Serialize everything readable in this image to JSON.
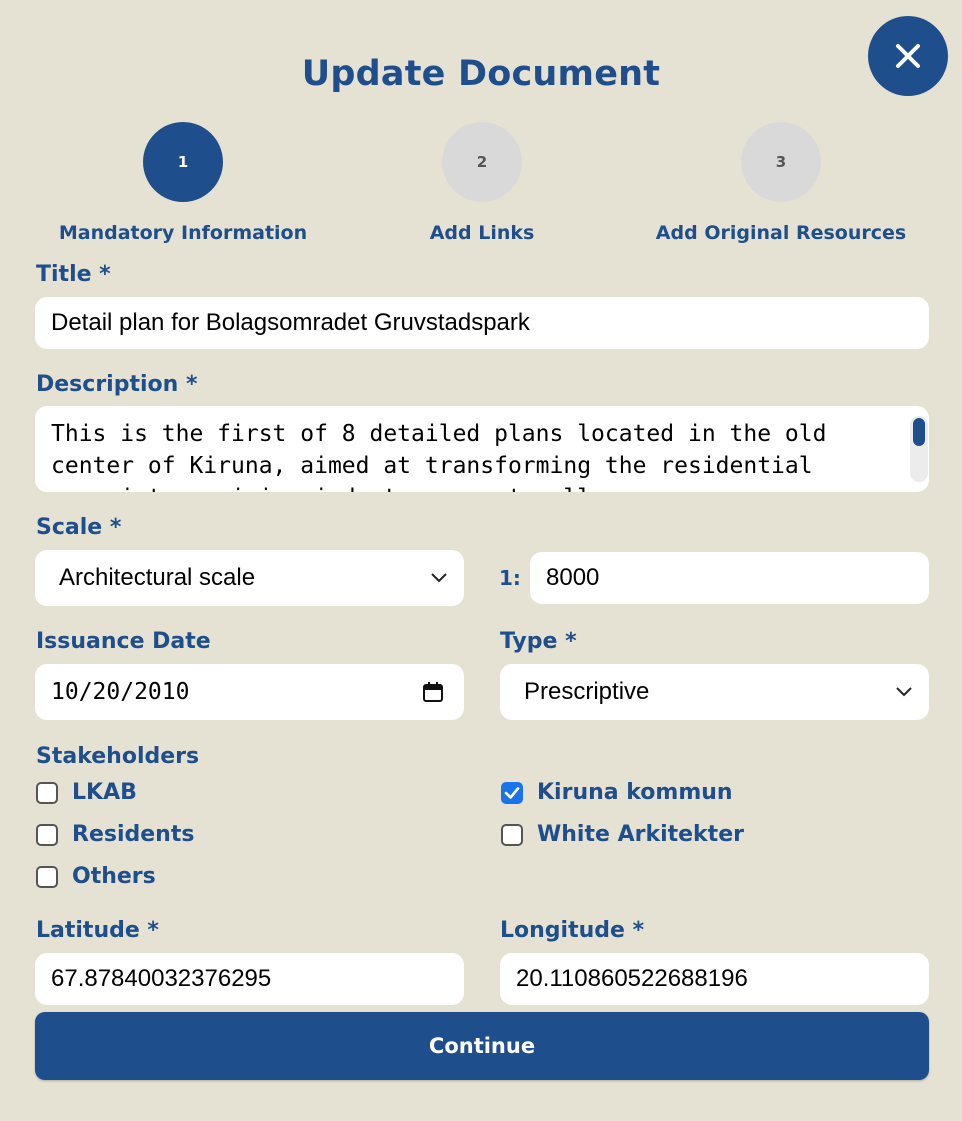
{
  "dialog": {
    "title": "Update Document",
    "close_icon": "close-icon"
  },
  "steps": [
    {
      "number": "1",
      "label": "Mandatory Information",
      "active": true
    },
    {
      "number": "2",
      "label": "Add Links",
      "active": false
    },
    {
      "number": "3",
      "label": "Add Original Resources",
      "active": false
    }
  ],
  "form": {
    "title": {
      "label": "Title *",
      "value": "Detail plan for Bolagsomradet Gruvstadspark"
    },
    "description": {
      "label": "Description *",
      "value": "This is the first of 8 detailed plans located in the old center of Kiruna, aimed at transforming the residential area into a mining industry zone to allow"
    },
    "scale": {
      "label": "Scale *",
      "selected": "Architectural scale",
      "ratio_prefix": "1:",
      "ratio_value": "8000"
    },
    "issuance_date": {
      "label": "Issuance Date",
      "value": "10/20/2010"
    },
    "type": {
      "label": "Type *",
      "selected": "Prescriptive"
    },
    "stakeholders": {
      "label": "Stakeholders",
      "options": [
        {
          "label": "LKAB",
          "checked": false
        },
        {
          "label": "Kiruna kommun",
          "checked": true
        },
        {
          "label": "Residents",
          "checked": false
        },
        {
          "label": "White Arkitekter",
          "checked": false
        },
        {
          "label": "Others",
          "checked": false
        }
      ]
    },
    "latitude": {
      "label": "Latitude *",
      "value": "67.87840032376295"
    },
    "longitude": {
      "label": "Longitude *",
      "value": "20.110860522688196"
    }
  },
  "continue_label": "Continue",
  "colors": {
    "primary": "#1e4f8c",
    "background": "#e6e2d3",
    "step_inactive": "#d9d9d9",
    "checkbox_checked": "#1a73e8"
  }
}
